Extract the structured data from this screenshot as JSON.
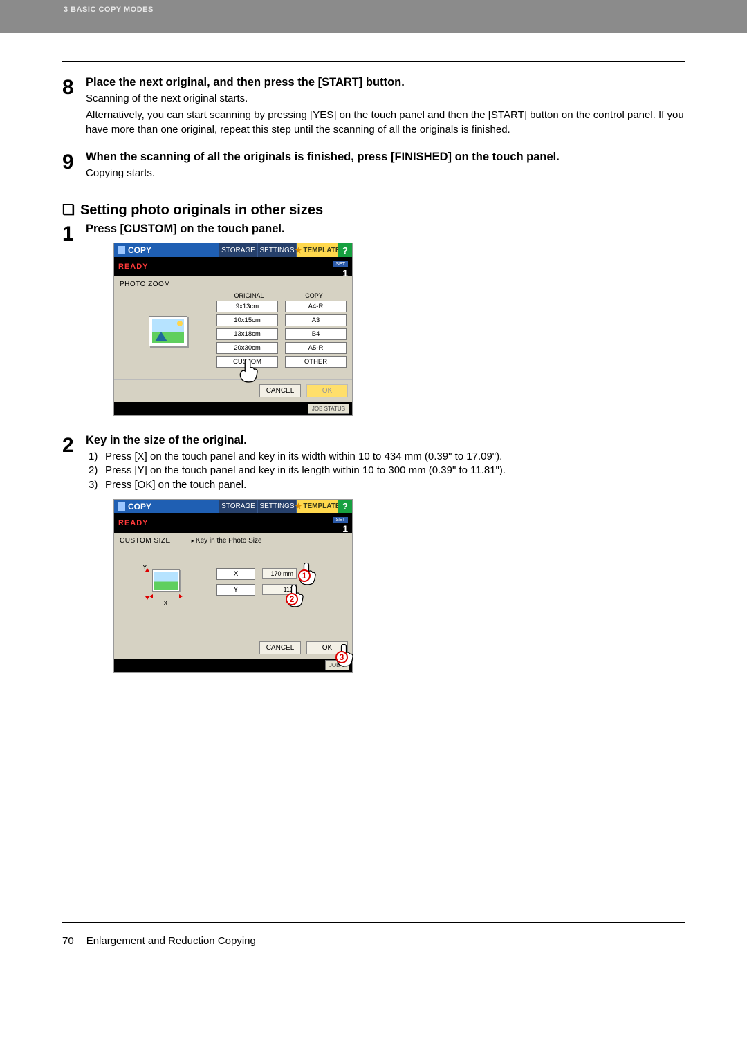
{
  "header": {
    "breadcrumb": "3 BASIC COPY MODES"
  },
  "steps_top": [
    {
      "num": "8",
      "title": "Place the next original, and then press the [START] button.",
      "lines": [
        "Scanning of the next original starts.",
        "Alternatively, you can start scanning by pressing [YES] on the touch panel and then the [START] button on the control panel. If you have more than one original, repeat this step until the scanning of all the originals is finished."
      ]
    },
    {
      "num": "9",
      "title": "When the scanning of all the originals is finished, press [FINISHED] on the touch panel.",
      "lines": [
        "Copying starts."
      ]
    }
  ],
  "section_title": "Setting photo originals in other sizes",
  "step1": {
    "num": "1",
    "title": "Press [CUSTOM] on the touch panel."
  },
  "panel1": {
    "tabs": {
      "copy": "COPY",
      "storage": "STORAGE",
      "settings": "SETTINGS",
      "template": "TEMPLATE",
      "help": "?"
    },
    "status": "READY",
    "set_label": "SET",
    "set_count": "1",
    "mode_label": "PHOTO ZOOM",
    "col_original": "ORIGINAL",
    "col_copy": "COPY",
    "rows": [
      {
        "orig": "9x13cm",
        "copy": "A4-R"
      },
      {
        "orig": "10x15cm",
        "copy": "A3"
      },
      {
        "orig": "13x18cm",
        "copy": "B4"
      },
      {
        "orig": "20x30cm",
        "copy": "A5-R"
      },
      {
        "orig": "CUSTOM",
        "copy": "OTHER"
      }
    ],
    "footer": {
      "cancel": "CANCEL",
      "ok": "OK"
    },
    "job_status": "JOB STATUS"
  },
  "step2": {
    "num": "2",
    "title": "Key in the size of the original.",
    "subs": [
      {
        "n": "1)",
        "t": "Press [X] on the touch panel and key in its width within 10 to 434 mm (0.39\" to 17.09\")."
      },
      {
        "n": "2)",
        "t": "Press [Y] on the touch panel and key in its length within 10 to 300 mm (0.39\" to 11.81\")."
      },
      {
        "n": "3)",
        "t": "Press [OK] on the touch panel."
      }
    ]
  },
  "panel2": {
    "tabs": {
      "copy": "COPY",
      "storage": "STORAGE",
      "settings": "SETTINGS",
      "template": "TEMPLATE",
      "help": "?"
    },
    "status": "READY",
    "set_label": "SET",
    "set_count": "1",
    "mode_label": "CUSTOM SIZE",
    "hint": "Key in the Photo Size",
    "x_label": "X",
    "y_label": "Y",
    "x_val": "170 mm",
    "y_val": "113",
    "y_axis": "Y",
    "x_axis": "X",
    "footer": {
      "cancel": "CANCEL",
      "ok": "OK"
    },
    "job_status": "JOB S",
    "callouts": {
      "c1": "1",
      "c2": "2",
      "c3": "3"
    }
  },
  "footer": {
    "page": "70",
    "title": "Enlargement and Reduction Copying"
  }
}
